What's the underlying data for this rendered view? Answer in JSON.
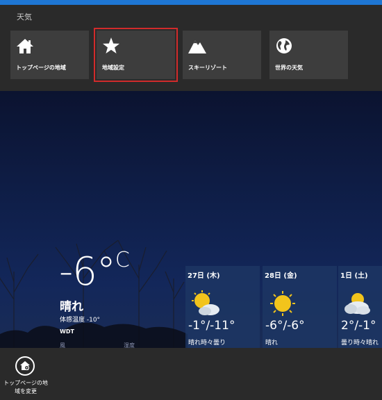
{
  "nav": {
    "title": "天気",
    "tiles": [
      {
        "label": "トップページの地域",
        "icon": "home-icon"
      },
      {
        "label": "地域設定",
        "icon": "star-icon"
      },
      {
        "label": "スキーリゾート",
        "icon": "mountain-icon"
      },
      {
        "label": "世界の天気",
        "icon": "globe-icon"
      }
    ]
  },
  "current": {
    "temp": "-6°",
    "unit": "C",
    "condition": "晴れ",
    "feels_like": "体感温度 -10°",
    "source": "WDT",
    "wind_label": "風",
    "humidity_label": "湿度"
  },
  "forecast": [
    {
      "day": "27日 (木)",
      "temp": "-1°/-11°",
      "cond": "晴れ時々曇り",
      "icon": "partly-cloudy-icon"
    },
    {
      "day": "28日 (金)",
      "temp": "-6°/-6°",
      "cond": "晴れ",
      "icon": "sunny-icon"
    },
    {
      "day": "1日 (土)",
      "temp": "2°/-1°",
      "cond": "曇り時々晴れ",
      "icon": "cloudy-sunny-icon"
    }
  ],
  "appbar": {
    "button_label": "トップページの地域を変更"
  },
  "colors": {
    "accent": "#1e76d3",
    "nav_bg": "#2a2a2a",
    "tile_bg": "#3d3d3d",
    "highlight": "#d22b2b",
    "sky_top": "#0b1330",
    "sky_bottom": "#1a2c55"
  }
}
